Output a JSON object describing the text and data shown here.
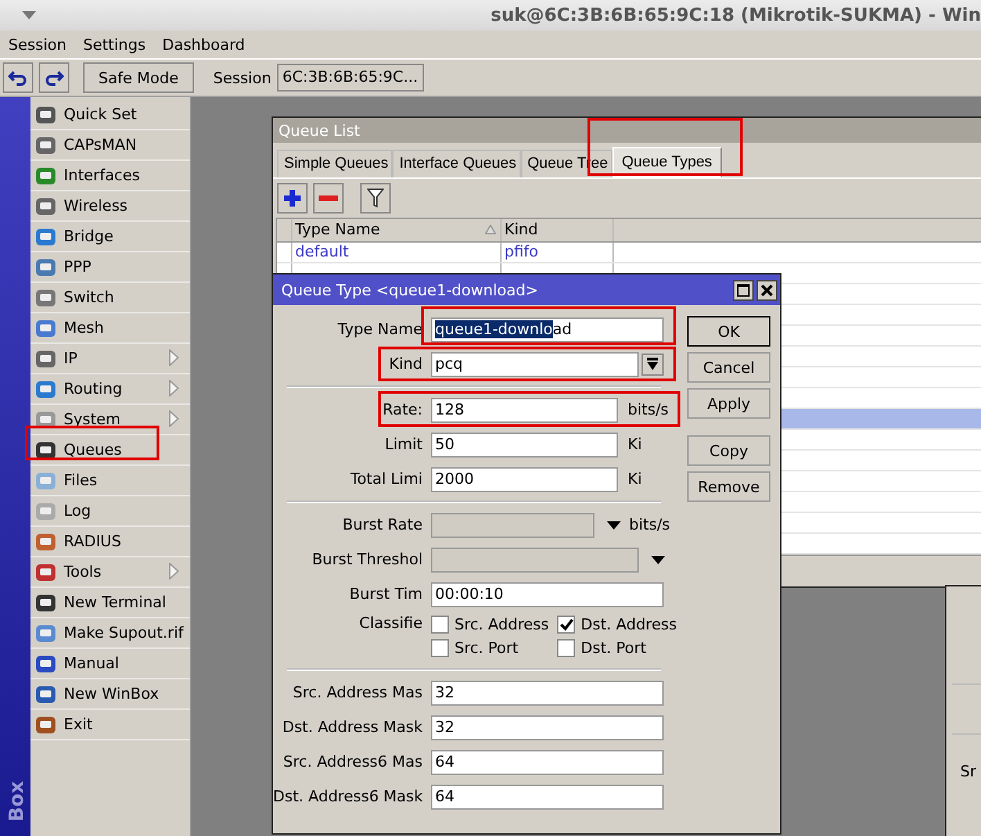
{
  "window": {
    "title": "suk@6C:3B:6B:65:9C:18 (Mikrotik-SUKMA) - Win"
  },
  "menu": [
    "Session",
    "Settings",
    "Dashboard"
  ],
  "toolbar": {
    "safe_mode": "Safe Mode",
    "session_label": "Session",
    "session_value": "6C:3B:6B:65:9C..."
  },
  "side_strip": "Box",
  "sidebar": {
    "items": [
      {
        "label": "Quick Set",
        "submenu": false
      },
      {
        "label": "CAPsMAN",
        "submenu": false
      },
      {
        "label": "Interfaces",
        "submenu": false
      },
      {
        "label": "Wireless",
        "submenu": false
      },
      {
        "label": "Bridge",
        "submenu": false
      },
      {
        "label": "PPP",
        "submenu": false
      },
      {
        "label": "Switch",
        "submenu": false
      },
      {
        "label": "Mesh",
        "submenu": false
      },
      {
        "label": "IP",
        "submenu": true
      },
      {
        "label": "Routing",
        "submenu": true
      },
      {
        "label": "System",
        "submenu": true
      },
      {
        "label": "Queues",
        "submenu": false
      },
      {
        "label": "Files",
        "submenu": false
      },
      {
        "label": "Log",
        "submenu": false
      },
      {
        "label": "RADIUS",
        "submenu": false
      },
      {
        "label": "Tools",
        "submenu": true
      },
      {
        "label": "New Terminal",
        "submenu": false
      },
      {
        "label": "Make Supout.rif",
        "submenu": false
      },
      {
        "label": "Manual",
        "submenu": false
      },
      {
        "label": "New WinBox",
        "submenu": false
      },
      {
        "label": "Exit",
        "submenu": false
      }
    ]
  },
  "queue_list": {
    "title": "Queue List",
    "tabs": [
      {
        "label": "Simple Queues",
        "selected": false
      },
      {
        "label": "Interface Queues",
        "selected": false
      },
      {
        "label": "Queue Tree",
        "selected": false
      },
      {
        "label": "Queue Types",
        "selected": true
      }
    ],
    "table": {
      "columns": [
        "Type Name",
        "Kind"
      ],
      "rows": [
        {
          "type_name": "default",
          "kind": "pfifo",
          "selected": false
        },
        {
          "selected": false
        },
        {
          "selected": false
        },
        {
          "selected": false
        },
        {
          "selected": false
        },
        {
          "selected": false
        },
        {
          "selected": false
        },
        {
          "selected": false
        },
        {
          "selected": true
        },
        {
          "selected": false
        },
        {
          "selected": false
        },
        {
          "selected": false
        },
        {
          "selected": false
        },
        {
          "selected": false
        },
        {
          "selected": false
        }
      ]
    }
  },
  "back_window": {
    "label": "Sr"
  },
  "dialog": {
    "title": "Queue Type <queue1-download>",
    "fields": [
      {
        "kind": "selection",
        "label": "Type Name",
        "selected_text": "queue1-downlo",
        "rest": "ad"
      },
      {
        "kind": "select",
        "label": "Kind",
        "value": "pcq"
      },
      {
        "kind": "separator"
      },
      {
        "kind": "unit",
        "label": "Rate:",
        "value": "128",
        "unit": "bits/s"
      },
      {
        "kind": "unit",
        "label": "Limit",
        "value": "50",
        "unit": "Ki"
      },
      {
        "kind": "unit",
        "label": "Total Limi",
        "value": "2000",
        "unit": "Ki"
      },
      {
        "kind": "separator"
      },
      {
        "kind": "disabled_unit",
        "label": "Burst Rate",
        "unit": "bits/s"
      },
      {
        "kind": "disabled_arrow",
        "label": "Burst Threshol"
      },
      {
        "kind": "text",
        "label": "Burst Tim",
        "value": "00:00:10"
      },
      {
        "kind": "checks",
        "label": "Classifie",
        "options": [
          {
            "label": "Src. Address",
            "checked": false
          },
          {
            "label": "Dst. Address",
            "checked": true
          },
          {
            "label": "Src. Port",
            "checked": false
          },
          {
            "label": "Dst. Port",
            "checked": false
          }
        ]
      },
      {
        "kind": "separator"
      },
      {
        "kind": "text",
        "label": "Src. Address Mas",
        "value": "32"
      },
      {
        "kind": "text",
        "label": "Dst. Address Mask",
        "value": "32"
      },
      {
        "kind": "text",
        "label": "Src. Address6 Mas",
        "value": "64"
      },
      {
        "kind": "text",
        "label": "Dst. Address6 Mask",
        "value": "64"
      }
    ],
    "buttons": [
      {
        "label": "OK",
        "focused": true
      },
      {
        "label": "Cancel",
        "focused": false
      },
      {
        "label": "Apply",
        "focused": false
      },
      {
        "label": "Copy",
        "focused": false
      },
      {
        "label": "Remove",
        "focused": false
      }
    ]
  }
}
